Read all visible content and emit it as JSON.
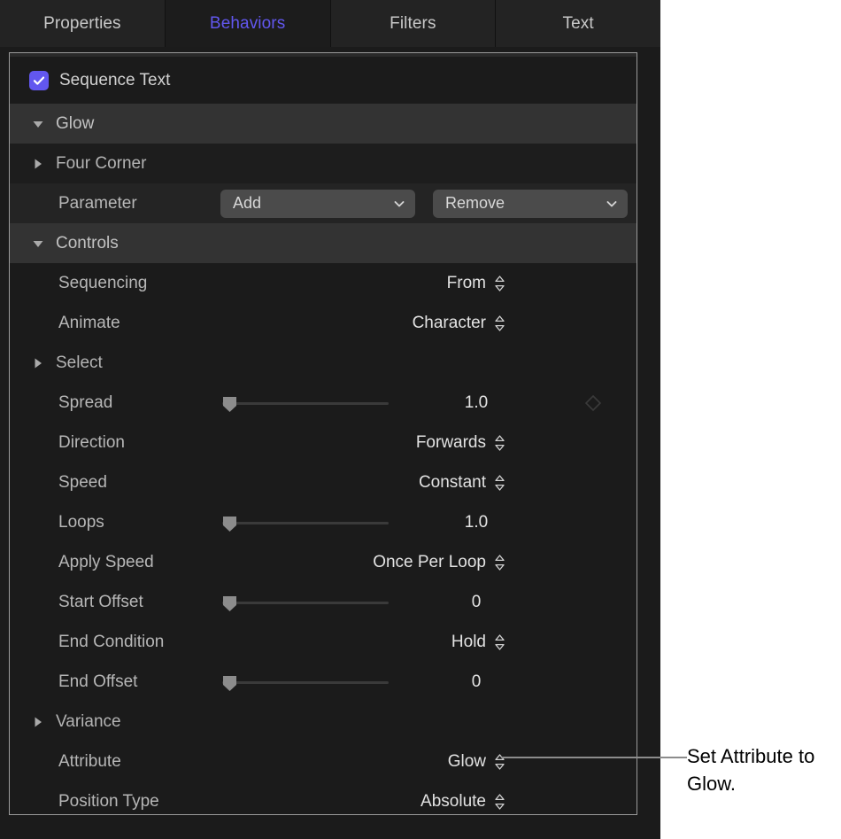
{
  "tabs": [
    {
      "label": "Properties",
      "selected": false
    },
    {
      "label": "Behaviors",
      "selected": true
    },
    {
      "label": "Filters",
      "selected": false
    },
    {
      "label": "Text",
      "selected": false
    }
  ],
  "colors": {
    "accent": "#6257ef",
    "panel_bg": "#1d1d1d",
    "row_group": "#333333",
    "row_dark": "#1b1b1b",
    "popup_bg": "#4b4b4b",
    "label_text": "#b7b7b7",
    "value_text": "#e4e4e4",
    "border": "#9a9a9a",
    "callout_text": "#000000"
  },
  "panel": {
    "checkbox_row": {
      "label": "Sequence Text",
      "checked": true,
      "icon": "checkmark-icon"
    },
    "rows": [
      {
        "kind": "group",
        "name": "glow",
        "label": "Glow",
        "disclosure": "triangle-down-icon",
        "expanded": true
      },
      {
        "kind": "group-sub",
        "name": "four-corner",
        "label": "Four Corner",
        "disclosure": "triangle-right-icon",
        "expanded": false
      },
      {
        "kind": "popups",
        "name": "parameter",
        "label": "Parameter",
        "popup_left": {
          "value": "Add",
          "icon": "chevron-down-icon"
        },
        "popup_right": {
          "value": "Remove",
          "icon": "chevron-down-icon"
        }
      },
      {
        "kind": "group",
        "name": "controls",
        "label": "Controls",
        "disclosure": "triangle-down-icon",
        "expanded": true
      },
      {
        "kind": "stepper",
        "name": "sequencing",
        "label": "Sequencing",
        "value": "From",
        "icon": "stepper-updown-icon"
      },
      {
        "kind": "stepper",
        "name": "animate",
        "label": "Animate",
        "value": "Character",
        "icon": "stepper-updown-icon"
      },
      {
        "kind": "group-sub",
        "name": "select",
        "label": "Select",
        "disclosure": "triangle-right-icon",
        "expanded": false
      },
      {
        "kind": "slider",
        "name": "spread",
        "label": "Spread",
        "value": "1.0",
        "handle_pct": 2,
        "keyframe": true,
        "keyframe_icon": "keyframe-diamond-icon"
      },
      {
        "kind": "stepper",
        "name": "direction",
        "label": "Direction",
        "value": "Forwards",
        "icon": "stepper-updown-icon"
      },
      {
        "kind": "stepper",
        "name": "speed",
        "label": "Speed",
        "value": "Constant",
        "icon": "stepper-updown-icon"
      },
      {
        "kind": "slider",
        "name": "loops",
        "label": "Loops",
        "value": "1.0",
        "handle_pct": 2,
        "keyframe": false
      },
      {
        "kind": "stepper",
        "name": "apply-speed",
        "label": "Apply Speed",
        "value": "Once Per Loop",
        "icon": "stepper-updown-icon"
      },
      {
        "kind": "slider",
        "name": "start-offset",
        "label": "Start Offset",
        "value": "0",
        "handle_pct": 2,
        "keyframe": false
      },
      {
        "kind": "stepper",
        "name": "end-condition",
        "label": "End Condition",
        "value": "Hold",
        "icon": "stepper-updown-icon"
      },
      {
        "kind": "slider",
        "name": "end-offset",
        "label": "End Offset",
        "value": "0",
        "handle_pct": 2,
        "keyframe": false
      },
      {
        "kind": "group-sub",
        "name": "variance",
        "label": "Variance",
        "disclosure": "triangle-right-icon",
        "expanded": false
      },
      {
        "kind": "stepper",
        "name": "attribute",
        "label": "Attribute",
        "value": "Glow",
        "icon": "stepper-updown-icon"
      },
      {
        "kind": "stepper",
        "name": "position-type",
        "label": "Position Type",
        "value": "Absolute",
        "icon": "stepper-updown-icon"
      }
    ]
  },
  "callout": {
    "text": "Set Attribute to Glow."
  }
}
